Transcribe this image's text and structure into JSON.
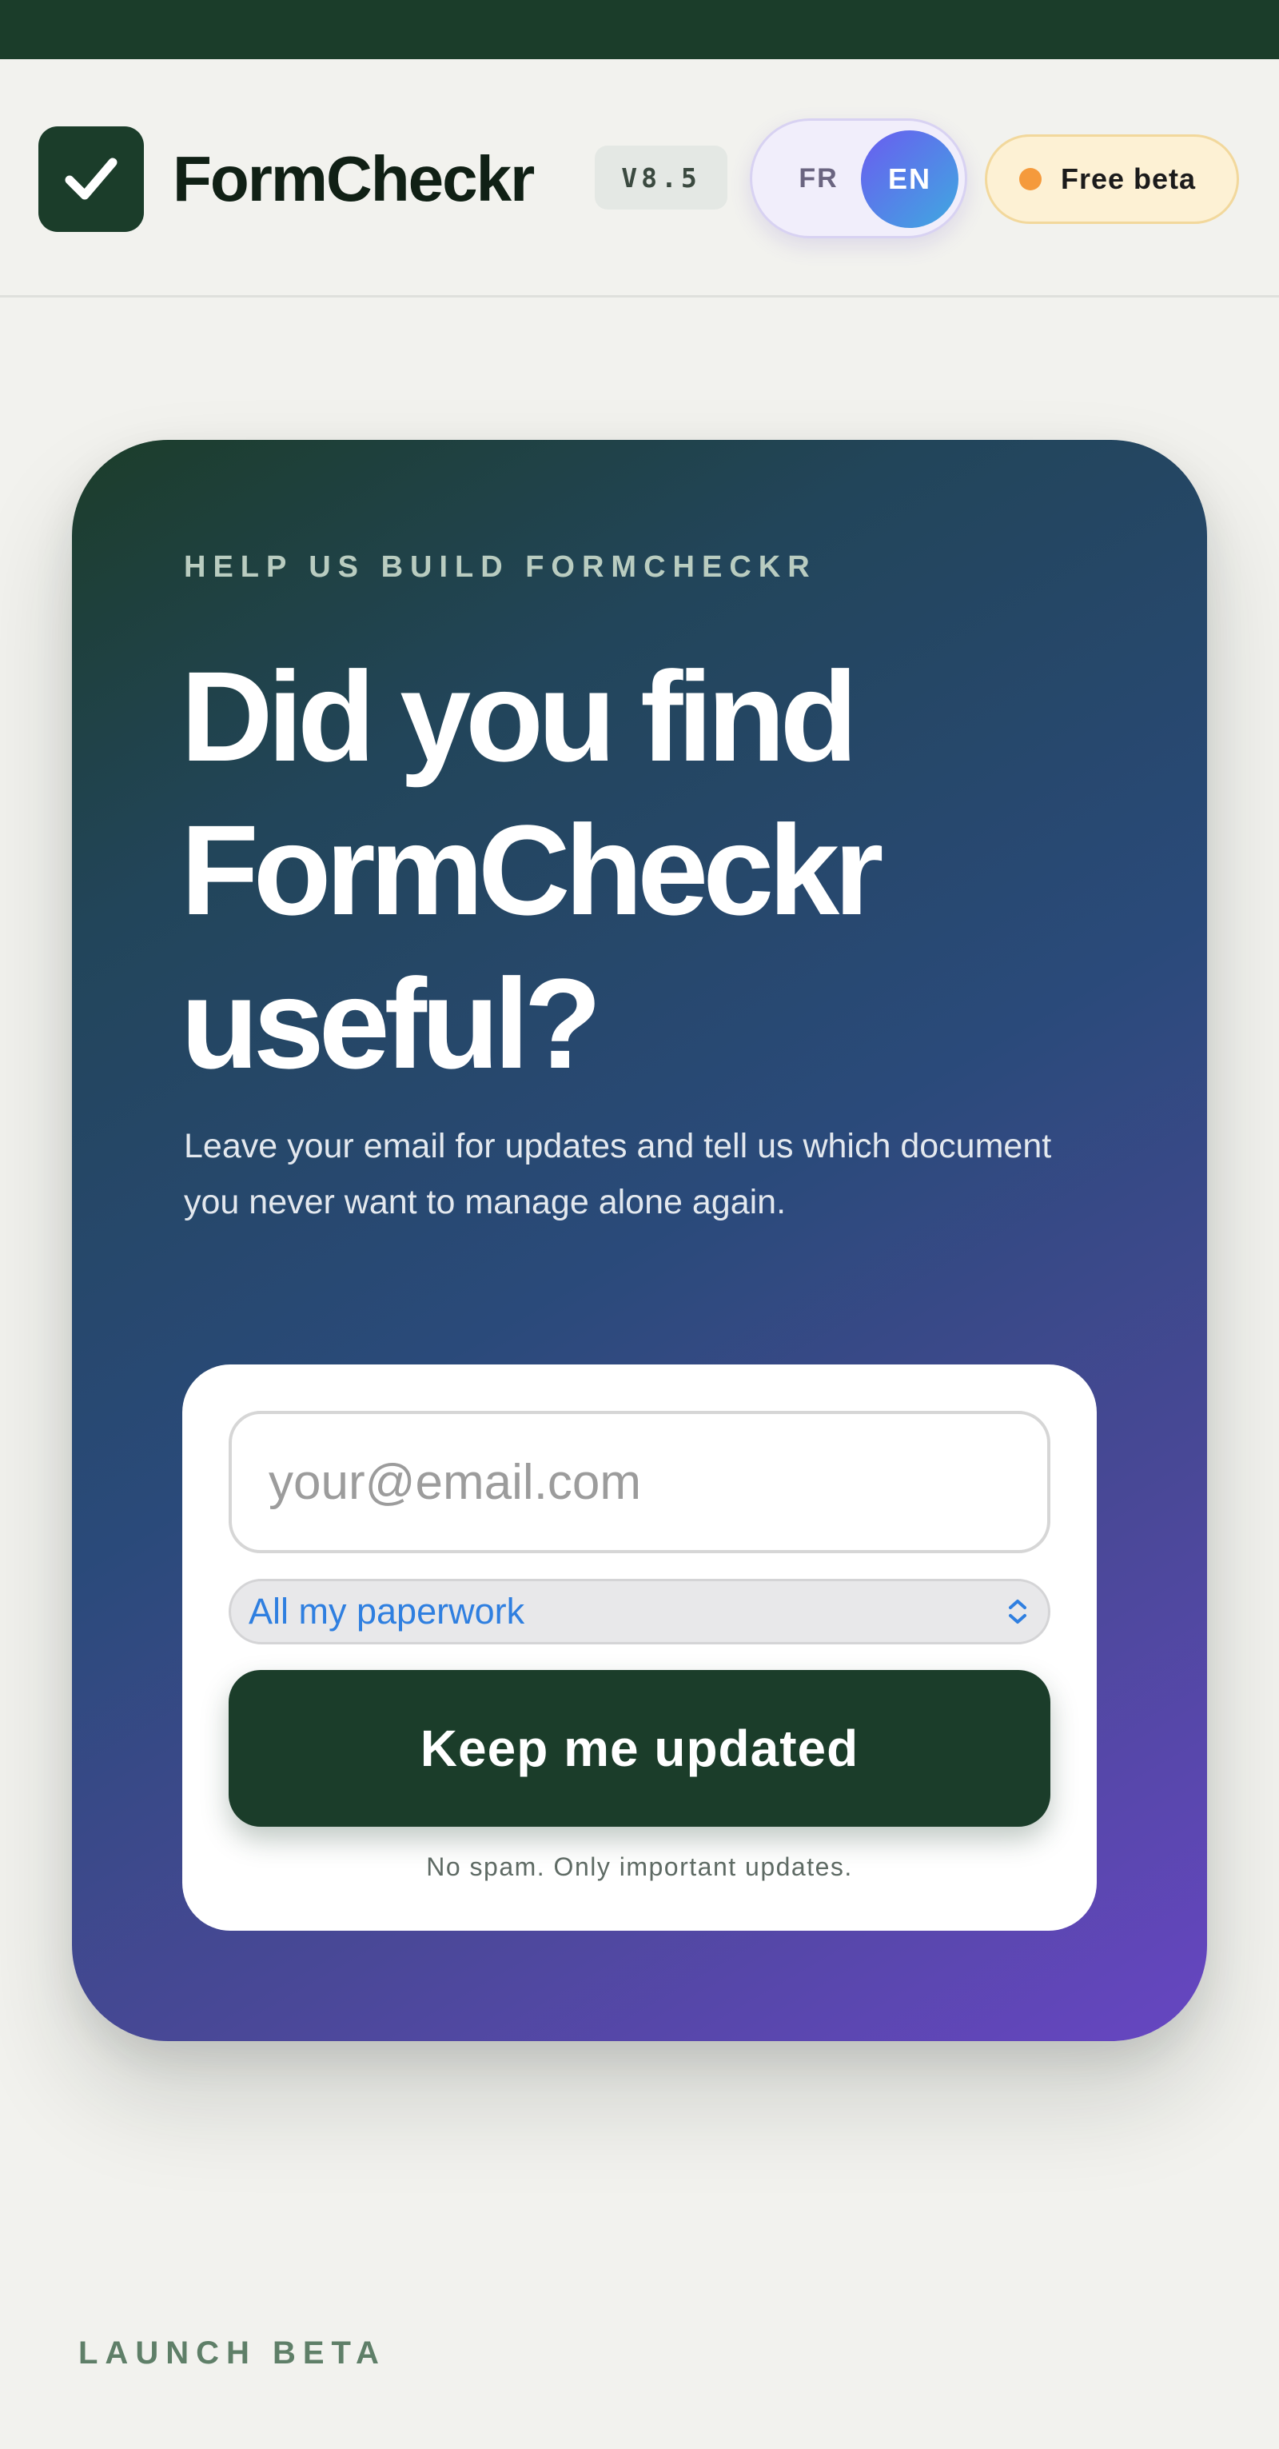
{
  "header": {
    "brand": "FormCheckr",
    "version": "V8.5",
    "languages": {
      "fr": "FR",
      "en": "EN",
      "active": "EN"
    },
    "beta_badge": "Free beta"
  },
  "hero": {
    "eyebrow": "HELP US BUILD FORMCHECKR",
    "headline": "Did you find FormCheckr useful?",
    "subtext": "Leave your email for updates and tell us which document you never want to manage alone again.",
    "form": {
      "email_placeholder": "your@email.com",
      "email_value": "",
      "select_value": "All my paperwork",
      "submit_label": "Keep me updated",
      "fine_print": "No spam. Only important updates."
    }
  },
  "footer": {
    "label": "LAUNCH BETA"
  },
  "colors": {
    "brand_green": "#1b3d2a",
    "accent_blue": "#2f7fe0",
    "beta_dot": "#f59a3c",
    "gradient_start": "#1c3d2a",
    "gradient_end": "#6746c2"
  }
}
